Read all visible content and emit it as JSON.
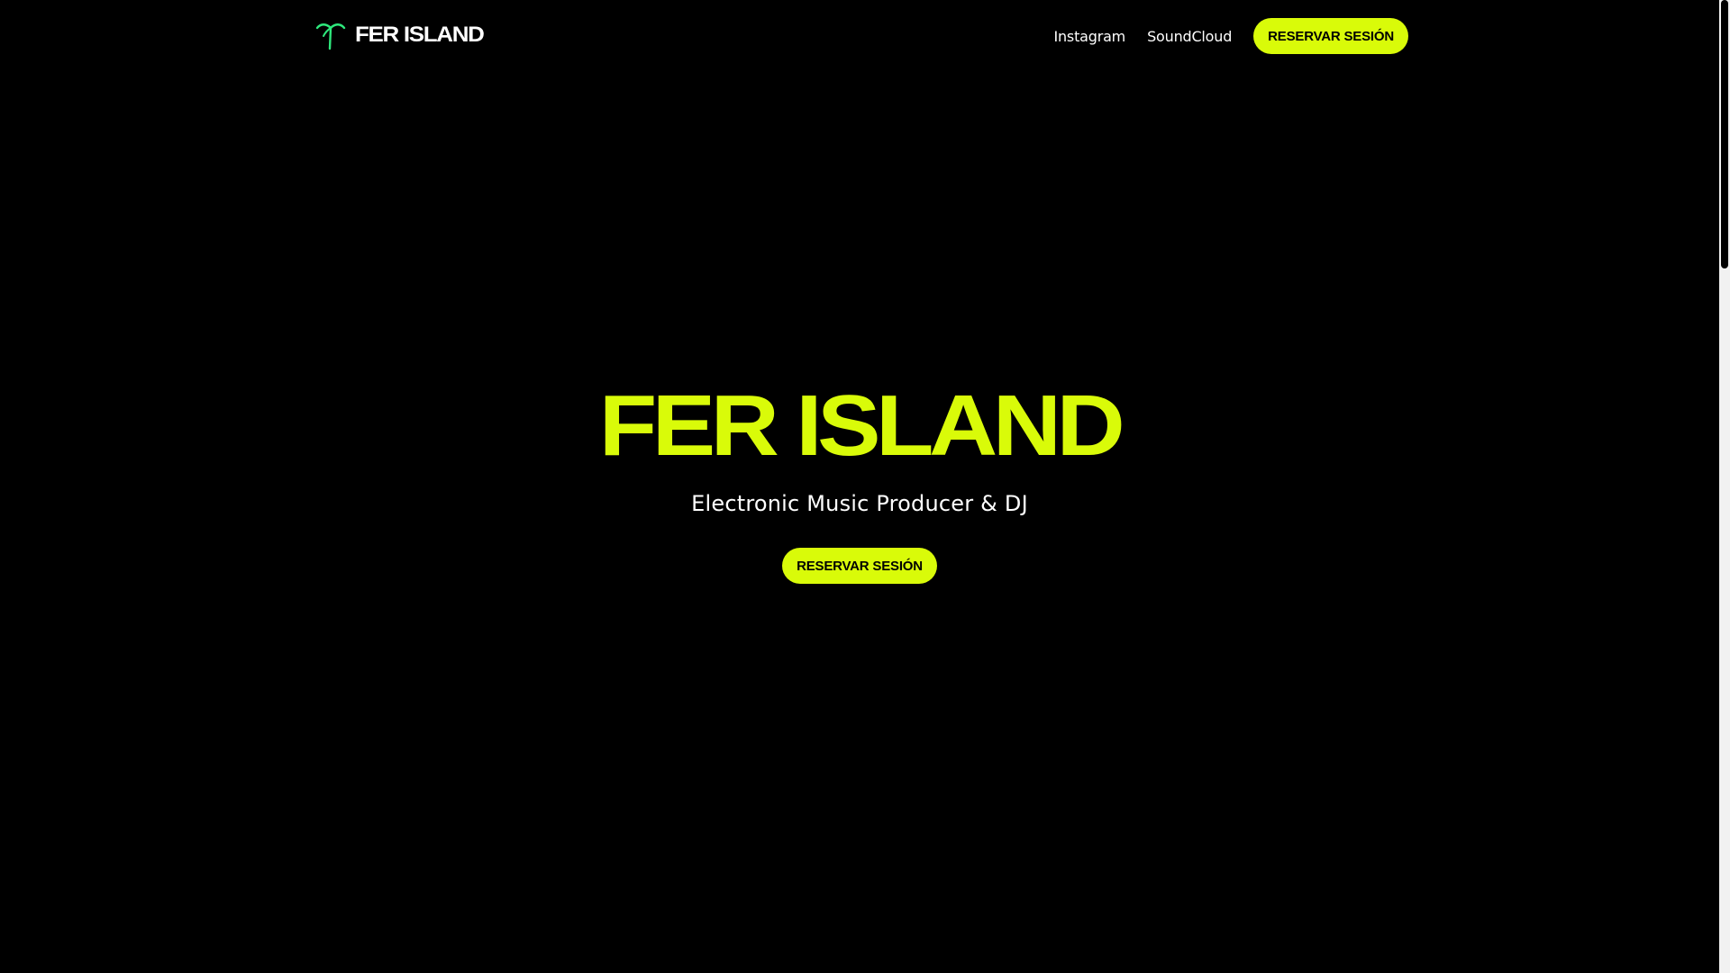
{
  "nav": {
    "logo_text": "FER ISLAND",
    "logo_icon": "palm-tree-icon",
    "links": [
      {
        "label": "Instagram"
      },
      {
        "label": "SoundCloud"
      }
    ],
    "cta_label": "RESERVAR SESIÓN"
  },
  "hero": {
    "title": "FER ISLAND",
    "subtitle": "Electronic Music Producer & DJ",
    "cta_label": "RESERVAR SESIÓN"
  },
  "colors": {
    "background": "#000000",
    "accent": "#d9fb09",
    "logo_icon": "#2ee87c",
    "text": "#ffffff"
  }
}
